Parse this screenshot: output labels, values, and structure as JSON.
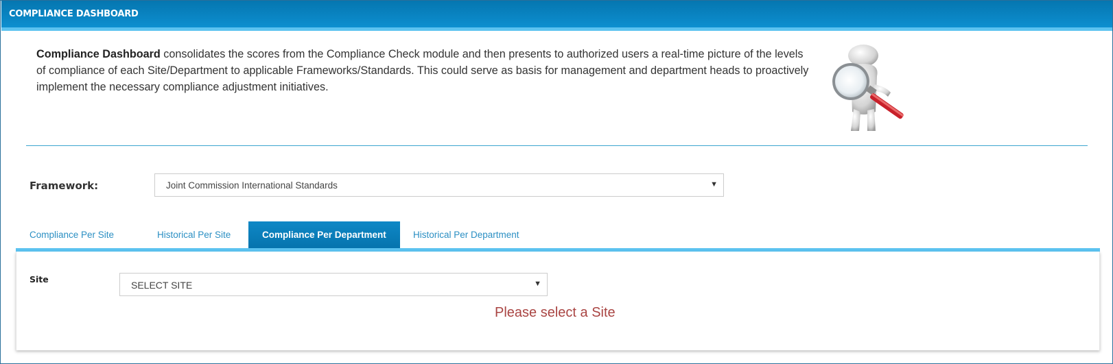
{
  "header": {
    "title": "COMPLIANCE DASHBOARD"
  },
  "intro": {
    "bold": "Compliance Dashboard",
    "text": " consolidates the scores from the Compliance Check module and then presents to authorized users a real-time picture of the levels of compliance of each Site/Department to applicable Frameworks/Standards. This could serve as basis for management and department heads to proactively implement the necessary compliance adjustment initiatives."
  },
  "framework": {
    "label": "Framework:",
    "selected": "Joint Commission International Standards"
  },
  "tabs": [
    {
      "label": "Compliance Per Site",
      "active": false
    },
    {
      "label": "Historical Per Site",
      "active": false
    },
    {
      "label": "Compliance Per Department",
      "active": true
    },
    {
      "label": "Historical Per Department",
      "active": false
    }
  ],
  "panel": {
    "site_label": "Site",
    "site_selected": "SELECT SITE",
    "message": "Please select a Site"
  },
  "colors": {
    "header_blue": "#0576b0",
    "accent_bar": "#5cc3f0",
    "tab_link": "#2b8fc3",
    "message": "#a94442"
  },
  "icons": {
    "caret": "caret-down-icon",
    "mascot": "magnifier-figure-icon"
  }
}
